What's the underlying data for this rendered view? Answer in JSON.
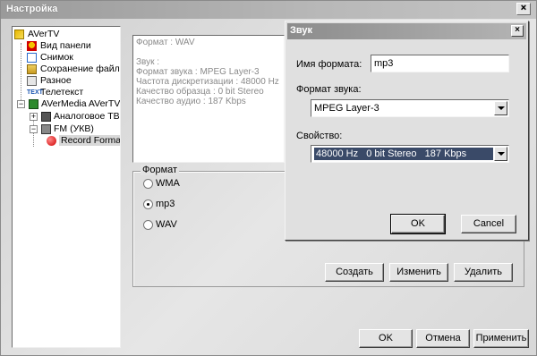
{
  "window": {
    "title": "Настройка"
  },
  "tree": {
    "items": [
      {
        "label": "AVerTV",
        "icon": "app-folder-icon"
      },
      {
        "label": "Вид панели",
        "icon": "panel-view-icon"
      },
      {
        "label": "Снимок",
        "icon": "snapshot-icon"
      },
      {
        "label": "Сохранение файлов",
        "icon": "save-files-icon"
      },
      {
        "label": "Разное",
        "icon": "misc-icon"
      },
      {
        "label": "Телетекст",
        "icon": "teletext-icon"
      },
      {
        "label": "AVerMedia AVerTV M",
        "icon": "device-icon"
      },
      {
        "label": "Аналоговое ТВ",
        "icon": "analog-tv-icon"
      },
      {
        "label": "FM (УКВ)",
        "icon": "fm-radio-icon"
      },
      {
        "label": "Record Forma",
        "icon": "record-icon"
      }
    ]
  },
  "info": {
    "lines": [
      "Формат : WAV",
      "",
      "Звук :",
      "Формат звука : MPEG Layer-3",
      "Частота дискретизации : 48000 Hz",
      "Качество образца : 0 bit Stereo",
      "Качество аудио : 187 Kbps"
    ]
  },
  "format_group": {
    "legend": "Формат",
    "options": [
      "WMA",
      "mp3",
      "WAV"
    ],
    "selected": "mp3"
  },
  "format_buttons": {
    "create": "Создать",
    "edit": "Изменить",
    "delete": "Удалить"
  },
  "bottom_buttons": {
    "ok": "OK",
    "cancel": "Отмена",
    "apply": "Применить"
  },
  "dialog": {
    "title": "Звук",
    "format_name_label": "Имя формата:",
    "format_name_value": "mp3",
    "sound_format_label": "Формат звука:",
    "sound_format_value": "MPEG Layer-3",
    "property_label": "Свойство:",
    "property_value": "48000 Hz   0 bit Stereo   187 Kbps",
    "ok": "OK",
    "cancel": "Cancel"
  }
}
